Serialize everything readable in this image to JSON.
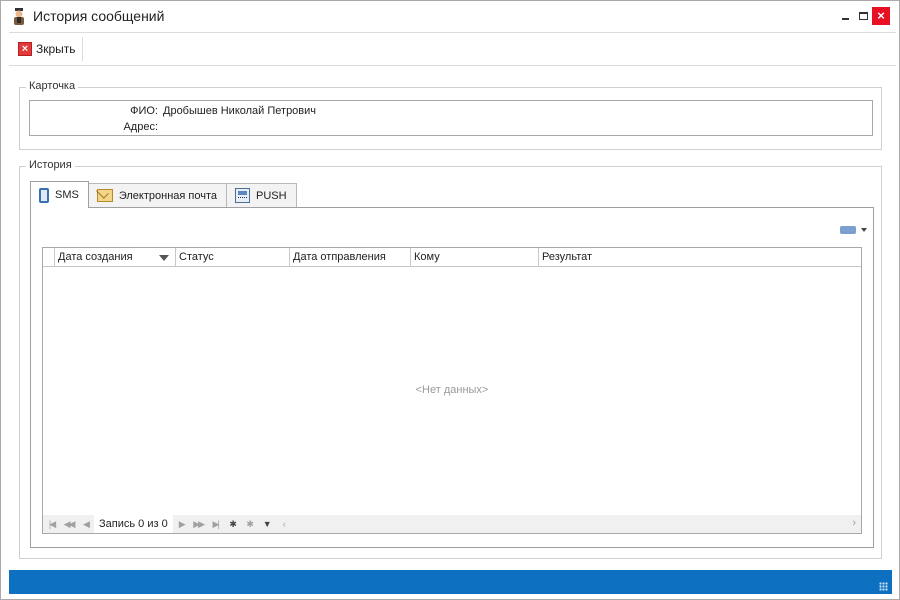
{
  "window": {
    "title": "История сообщений",
    "icons": {
      "app": "agent-icon",
      "minimize": "minimize-icon",
      "maximize": "maximize-icon",
      "close": "close-icon"
    }
  },
  "toolbar": {
    "close_label": "Зкрыть",
    "close_icon": "red-x-icon"
  },
  "card": {
    "legend": "Карточка",
    "fio_label": "ФИО:",
    "fio_value": "Дробышев Николай Петрович",
    "address_label": "Адрес:",
    "address_value": ""
  },
  "history": {
    "legend": "История",
    "tabs": [
      {
        "label": "SMS",
        "icon": "phone-icon",
        "active": true
      },
      {
        "label": "Электронная почта",
        "icon": "mail-icon",
        "active": false
      },
      {
        "label": "PUSH",
        "icon": "push-icon",
        "active": false
      }
    ],
    "grid": {
      "columns": [
        "Дата создания",
        "Статус",
        "Дата отправления",
        "Кому",
        "Результат"
      ],
      "rows": [],
      "empty_text": "<Нет данных>",
      "record_info": "Запись 0 из 0"
    }
  },
  "colors": {
    "statusbar": "#0e70c0",
    "accent": "#3a6fb0",
    "close_red": "#e81123"
  }
}
